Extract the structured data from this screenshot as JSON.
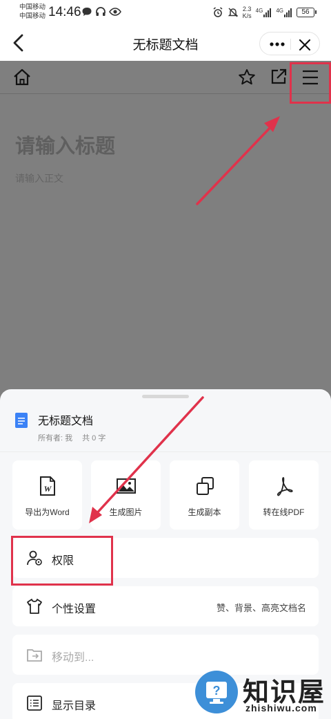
{
  "status_bar": {
    "carrier_1": "中国移动",
    "carrier_2": "中国移动",
    "time": "14:46",
    "speed_value": "2.3",
    "speed_unit": "K/s",
    "net_1": "4G",
    "net_2": "4G",
    "battery": "56"
  },
  "nav": {
    "title": "无标题文档"
  },
  "document": {
    "title_placeholder": "请输入标题",
    "body_placeholder": "请输入正文"
  },
  "sheet": {
    "doc_name": "无标题文档",
    "owner": "所有者: 我",
    "word_count": "共 0 字",
    "actions": [
      {
        "label": "导出为Word",
        "icon": "word-file-icon"
      },
      {
        "label": "生成图片",
        "icon": "image-icon"
      },
      {
        "label": "生成副本",
        "icon": "copy-icon"
      },
      {
        "label": "转在线PDF",
        "icon": "pdf-icon"
      }
    ],
    "rows": [
      {
        "label": "权限",
        "icon": "user-permission-icon"
      },
      {
        "label": "个性设置",
        "icon": "tshirt-icon",
        "hint": "赞、背景、高亮文档名"
      },
      {
        "label": "移动到...",
        "icon": "folder-move-icon"
      },
      {
        "label": "显示目录",
        "icon": "outline-list-icon"
      }
    ]
  },
  "watermark": {
    "brand": "知识屋",
    "url": "zhishiwu.com"
  },
  "colors": {
    "annotation_red": "#e0324b",
    "doc_blue": "#3b82f6",
    "watermark_blue": "#3d8fd8"
  }
}
